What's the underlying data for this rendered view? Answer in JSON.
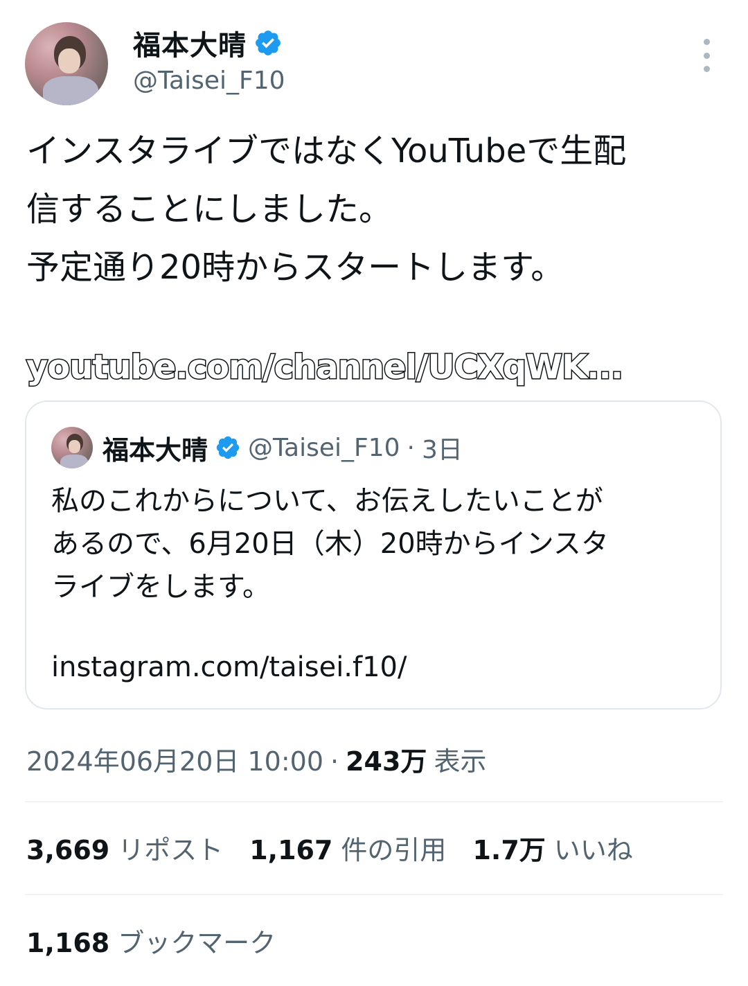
{
  "tweet": {
    "author": {
      "display_name": "福本大晴",
      "handle": "@Taisei_F10",
      "verified": true,
      "avatar": "profile-photo"
    },
    "text": "インスタライブではなくYouTubeで生配\n信することにしました。\n予定通り20時からスタートします。",
    "link": "youtube.com/channel/UCXqWK...",
    "more_icon": "more-vertical-icon"
  },
  "quoted_tweet": {
    "display_name": "福本大晴",
    "handle": "@Taisei_F10",
    "separator": "·",
    "time": "3日",
    "text": "私のこれからについて、お伝えしたいことが\nあるので、6月20日（木）20時からインスタ\nライブをします。",
    "link": "instagram.com/taisei.f10/"
  },
  "meta": {
    "datetime": "2024年06月20日 10:00",
    "separator": "·",
    "views_count": "243万",
    "views_label": "表示"
  },
  "stats": {
    "reposts_count": "3,669",
    "reposts_label": "リポスト",
    "quotes_count": "1,167",
    "quotes_label": "件の引用",
    "likes_count": "1.7万",
    "likes_label": "いいね",
    "bookmarks_count": "1,168",
    "bookmarks_label": "ブックマーク"
  },
  "colors": {
    "text_primary": "#0f1419",
    "text_secondary": "#536471",
    "verified_blue": "#1d9bf0",
    "border": "#e1e8ed"
  }
}
